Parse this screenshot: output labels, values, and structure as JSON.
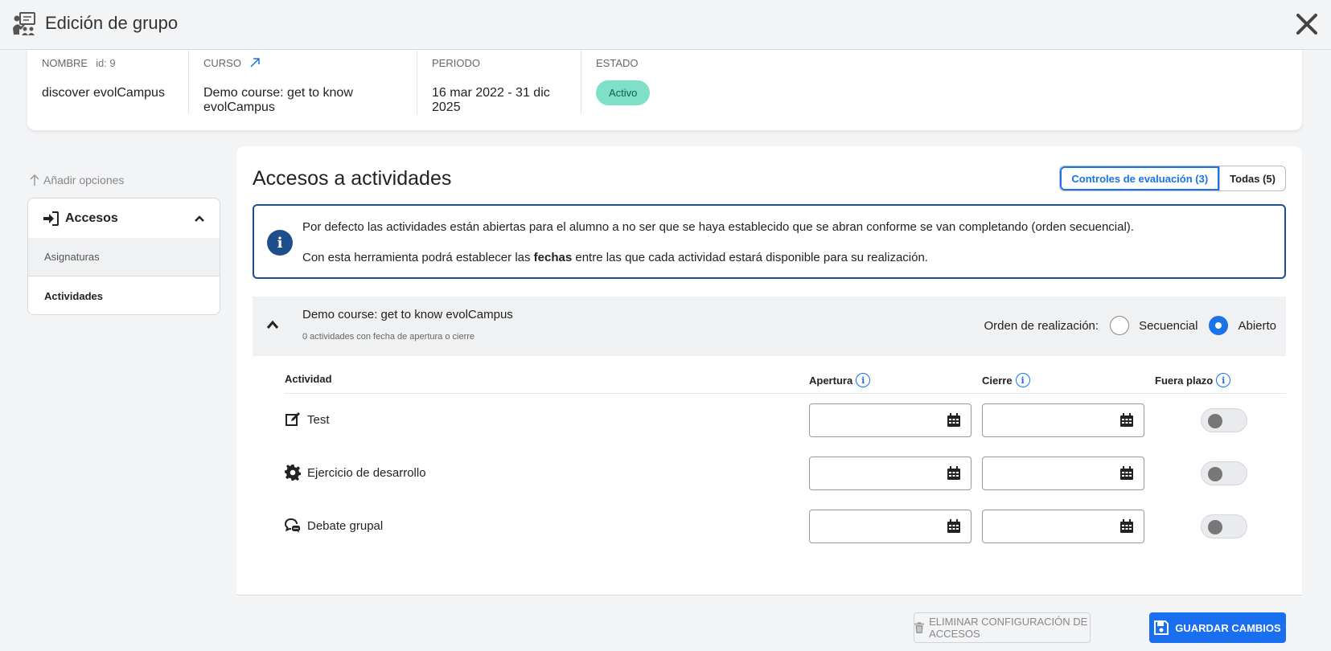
{
  "header": {
    "title": "Edición de grupo",
    "app_icon": "teacher-board-icon",
    "close_icon": "close-icon"
  },
  "group_info": {
    "name_label": "NOMBRE",
    "id_label": "id: 9",
    "name_value": "discover evolCampus",
    "course_label": "CURSO",
    "course_value": "Demo course: get to know evolCampus",
    "period_label": "PERIODO",
    "period_value": "16 mar 2022 - 31 dic 2025",
    "status_label": "ESTADO",
    "status_value": "Activo",
    "status_color": "#7ee0c6"
  },
  "sidebar": {
    "add_options": "Añadir opciones",
    "section_label": "Accesos",
    "items": [
      {
        "label": "Asignaturas"
      },
      {
        "label": "Actividades"
      }
    ]
  },
  "main": {
    "title": "Accesos a actividades",
    "filters": [
      {
        "label": "Controles de evaluación (3)"
      },
      {
        "label": "Todas (5)"
      }
    ],
    "info_line1": "Por defecto las actividades están abiertas para el alumno a no ser que se haya establecido que se abran conforme se van completando (orden secuencial).",
    "info_line2_pre": "Con esta herramienta podrá establecer las ",
    "info_line2_bold": "fechas",
    "info_line2_post": " entre las que cada actividad estará disponible para su realización.",
    "course": {
      "name": "Demo course: get to know evolCampus",
      "subtitle": "0 actividades con fecha de apertura o cierre",
      "order_label": "Orden de realización:",
      "option_sequential": "Secuencial",
      "option_open": "Abierto",
      "selected": "Abierto"
    },
    "table": {
      "col_activity": "Actividad",
      "col_opening": "Apertura",
      "col_closing": "Cierre",
      "col_late": "Fuera plazo",
      "rows": [
        {
          "icon": "edit-square-icon",
          "name": "Test",
          "opening": "",
          "closing": "",
          "late": false
        },
        {
          "icon": "gear-icon",
          "name": "Ejercicio de desarrollo",
          "opening": "",
          "closing": "",
          "late": false
        },
        {
          "icon": "chat-bubbles-icon",
          "name": "Debate grupal",
          "opening": "",
          "closing": "",
          "late": false
        }
      ]
    }
  },
  "footer": {
    "delete_label": "ELIMINAR CONFIGURACIÓN DE ACCESOS",
    "save_label": "GUARDAR CAMBIOS"
  },
  "colors": {
    "accent": "#1a73e8",
    "save_button": "#1a6ef0",
    "info_border": "#1f4e8c"
  }
}
